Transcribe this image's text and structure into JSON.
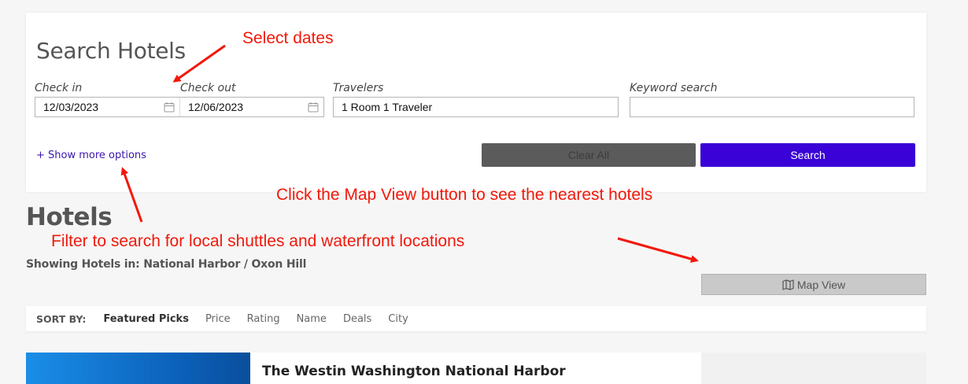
{
  "search": {
    "title": "Search Hotels",
    "checkin_label": "Check in",
    "checkout_label": "Check out",
    "travelers_label": "Travelers",
    "keyword_label": "Keyword search",
    "checkin_value": "12/03/2023",
    "checkout_value": "12/06/2023",
    "travelers_value": "1 Room 1 Traveler",
    "keyword_value": "",
    "more_options": "+ Show more options",
    "clear_label": "Clear All",
    "search_label": "Search"
  },
  "results": {
    "title": "Hotels",
    "showing": "Showing Hotels in: National Harbor / Oxon Hill",
    "map_view_label": "Map View"
  },
  "sort": {
    "label": "SORT BY:",
    "options": [
      "Featured Picks",
      "Price",
      "Rating",
      "Name",
      "Deals",
      "City"
    ]
  },
  "listing": {
    "name": "The Westin Washington National Harbor"
  },
  "annotations": {
    "select_dates": "Select dates",
    "map_view_hint": "Click the Map View button to see the nearest hotels",
    "filter_hint": "Filter to search for local shuttles and waterfront locations"
  },
  "colors": {
    "accent": "#3a02d6",
    "annotation": "#f2180a"
  }
}
